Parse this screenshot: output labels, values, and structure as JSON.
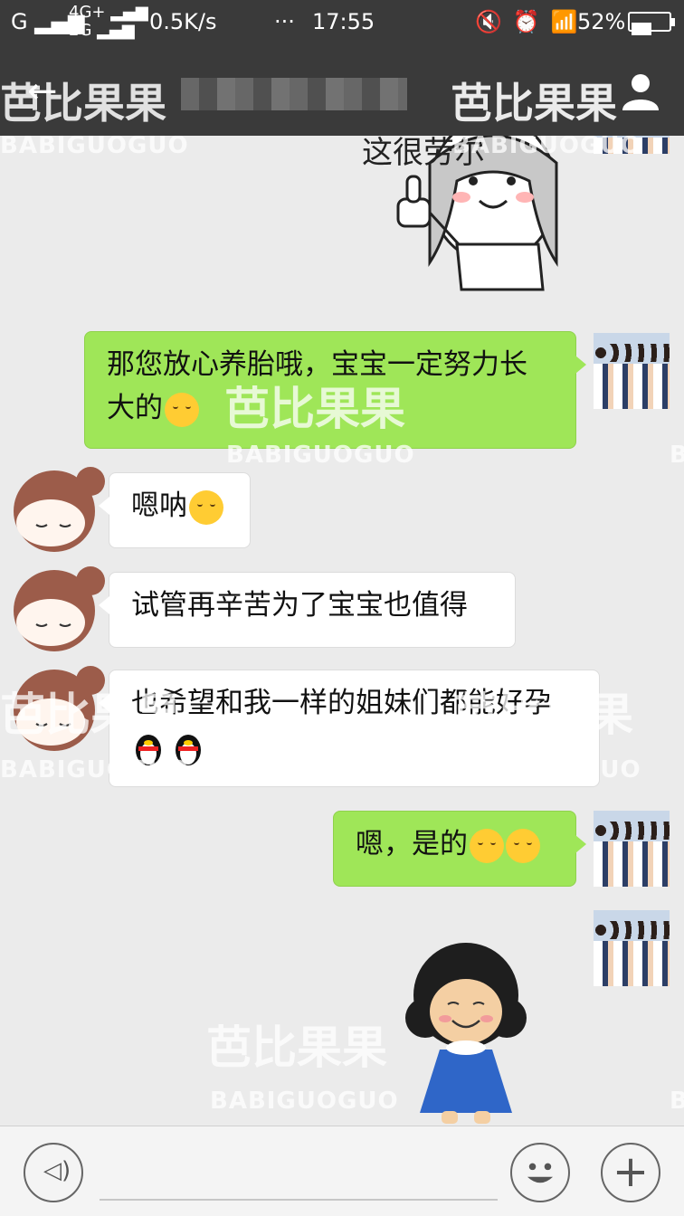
{
  "statusbar": {
    "carrier_signal": "G",
    "net_top": "4G+",
    "net_bottom": "2G",
    "speed": "0.5K/s",
    "dots": "···",
    "time": "17:55",
    "battery_pct": "52%"
  },
  "header": {
    "title": "芭比果果",
    "watermark": "芭比果果",
    "back_icon": "back-arrow-icon",
    "user_icon": "person-icon"
  },
  "watermarks": {
    "cn": "芭比果果",
    "en": "BABIGUOGUO"
  },
  "sticker_top": {
    "caption": "这很劳尔"
  },
  "messages": [
    {
      "side": "me",
      "text": "那您放心养胎哦，宝宝一定努力长大的",
      "emoji": "wink-tongue-emoji"
    },
    {
      "side": "other",
      "text": "嗯呐",
      "emoji": "shy-smile-emoji"
    },
    {
      "side": "other",
      "text": "试管再辛苦为了宝宝也值得"
    },
    {
      "side": "other",
      "text": "也希望和我一样的姐妹们都能好孕",
      "emoji": "penguin-emoji"
    },
    {
      "side": "me",
      "text": "嗯，是的",
      "emoji": "smile-emoji"
    }
  ],
  "colors": {
    "bg": "#ebebeb",
    "me_bubble": "#9fe658",
    "other_bubble": "#ffffff",
    "bar": "#3a3a3a"
  },
  "input": {
    "placeholder": ""
  }
}
